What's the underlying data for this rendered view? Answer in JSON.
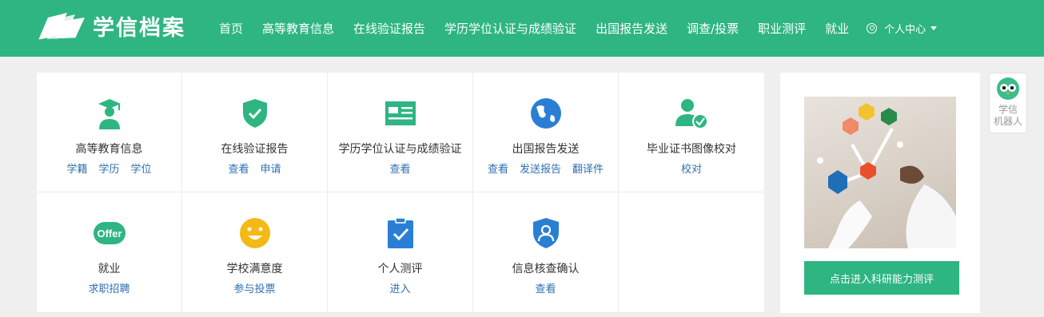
{
  "brand": {
    "name": "学信档案"
  },
  "nav": {
    "items": [
      "首页",
      "高等教育信息",
      "在线验证报告",
      "学历学位认证与成绩验证",
      "出国报告发送",
      "调查/投票",
      "职业测评",
      "就业"
    ],
    "user_center": "个人中心"
  },
  "services": [
    {
      "title": "高等教育信息",
      "links": [
        "学籍",
        "学历",
        "学位"
      ],
      "icon": "graduate-icon"
    },
    {
      "title": "在线验证报告",
      "links": [
        "查看",
        "申请"
      ],
      "icon": "shield-check-icon"
    },
    {
      "title": "学历学位认证与成绩验证",
      "links": [
        "查看"
      ],
      "icon": "id-card-icon"
    },
    {
      "title": "出国报告发送",
      "links": [
        "查看",
        "发送报告",
        "翻译件"
      ],
      "icon": "globe-icon"
    },
    {
      "title": "毕业证书图像校对",
      "links": [
        "校对"
      ],
      "icon": "user-check-icon"
    },
    {
      "title": "就业",
      "links": [
        "求职招聘"
      ],
      "icon": "offer-icon",
      "badge": "Offer"
    },
    {
      "title": "学校满意度",
      "links": [
        "参与投票"
      ],
      "icon": "smiley-icon"
    },
    {
      "title": "个人测评",
      "links": [
        "进入"
      ],
      "icon": "clipboard-check-icon"
    },
    {
      "title": "信息核查确认",
      "links": [
        "查看"
      ],
      "icon": "shield-user-icon"
    }
  ],
  "promo": {
    "button_label": "点击进入科研能力测评"
  },
  "robot": {
    "line1": "学信",
    "line2": "机器人"
  },
  "colors": {
    "brand_green": "#2eb582",
    "link_blue": "#2f6fb0",
    "globe_blue": "#2a7fd4",
    "smiley_yellow": "#f5b915"
  }
}
